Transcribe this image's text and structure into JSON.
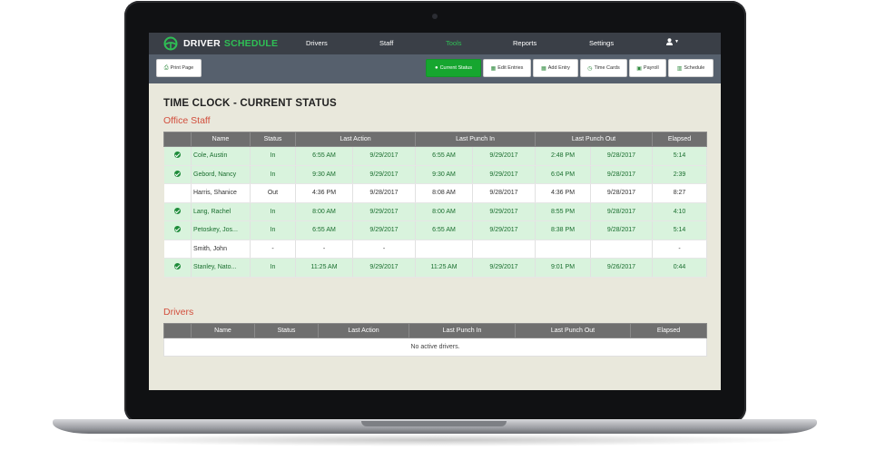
{
  "brand": {
    "part1": "DRIVER",
    "part2": "SCHEDULE"
  },
  "nav": {
    "drivers": "Drivers",
    "staff": "Staff",
    "tools": "Tools",
    "reports": "Reports",
    "settings": "Settings"
  },
  "toolbar": {
    "print": "Print Page",
    "current_status": "Current Status",
    "edit_entries": "Edit Entries",
    "add_entry": "Add Entry",
    "time_cards": "Time Cards",
    "payroll": "Payroll",
    "schedule": "Schedule"
  },
  "page_title": "TIME CLOCK - CURRENT STATUS",
  "office": {
    "title": "Office Staff",
    "headers": {
      "name": "Name",
      "status": "Status",
      "last_action": "Last Action",
      "last_punch_in": "Last Punch In",
      "last_punch_out": "Last Punch Out",
      "elapsed": "Elapsed"
    },
    "rows": [
      {
        "name": "Cole, Austin",
        "status": "In",
        "la_time": "6:55 AM",
        "la_date": "9/29/2017",
        "pi_time": "6:55 AM",
        "pi_date": "9/29/2017",
        "po_time": "2:48 PM",
        "po_date": "9/28/2017",
        "elapsed": "5:14"
      },
      {
        "name": "Gebord, Nancy",
        "status": "In",
        "la_time": "9:30 AM",
        "la_date": "9/29/2017",
        "pi_time": "9:30 AM",
        "pi_date": "9/29/2017",
        "po_time": "6:04 PM",
        "po_date": "9/28/2017",
        "elapsed": "2:39"
      },
      {
        "name": "Harris, Shanice",
        "status": "Out",
        "la_time": "4:36 PM",
        "la_date": "9/28/2017",
        "pi_time": "8:08 AM",
        "pi_date": "9/28/2017",
        "po_time": "4:36 PM",
        "po_date": "9/28/2017",
        "elapsed": "8:27"
      },
      {
        "name": "Lang, Rachel",
        "status": "In",
        "la_time": "8:00 AM",
        "la_date": "9/29/2017",
        "pi_time": "8:00 AM",
        "pi_date": "9/29/2017",
        "po_time": "8:55 PM",
        "po_date": "9/28/2017",
        "elapsed": "4:10"
      },
      {
        "name": "Petoskey, Jos...",
        "status": "In",
        "la_time": "6:55 AM",
        "la_date": "9/29/2017",
        "pi_time": "6:55 AM",
        "pi_date": "9/29/2017",
        "po_time": "8:38 PM",
        "po_date": "9/28/2017",
        "elapsed": "5:14"
      },
      {
        "name": "Smith, John",
        "status": "-",
        "la_time": "-",
        "la_date": "-",
        "pi_time": "",
        "pi_date": "",
        "po_time": "",
        "po_date": "",
        "elapsed": "-"
      },
      {
        "name": "Stanley, Nato...",
        "status": "In",
        "la_time": "11:25 AM",
        "la_date": "9/29/2017",
        "pi_time": "11:25 AM",
        "pi_date": "9/29/2017",
        "po_time": "9:01 PM",
        "po_date": "9/26/2017",
        "elapsed": "0:44"
      }
    ]
  },
  "drivers": {
    "title": "Drivers",
    "headers": {
      "name": "Name",
      "status": "Status",
      "last_action": "Last Action",
      "last_punch_in": "Last Punch In",
      "last_punch_out": "Last Punch Out",
      "elapsed": "Elapsed"
    },
    "empty": "No active drivers."
  },
  "colors": {
    "accent_green": "#16a62f",
    "row_in_bg": "#d9f3dd",
    "section_title": "#d24e3c",
    "nav_bg": "#3a3f47",
    "toolbar_bg": "#56606d"
  },
  "icons": {
    "user": "user-icon",
    "check": "check-circle-icon"
  }
}
